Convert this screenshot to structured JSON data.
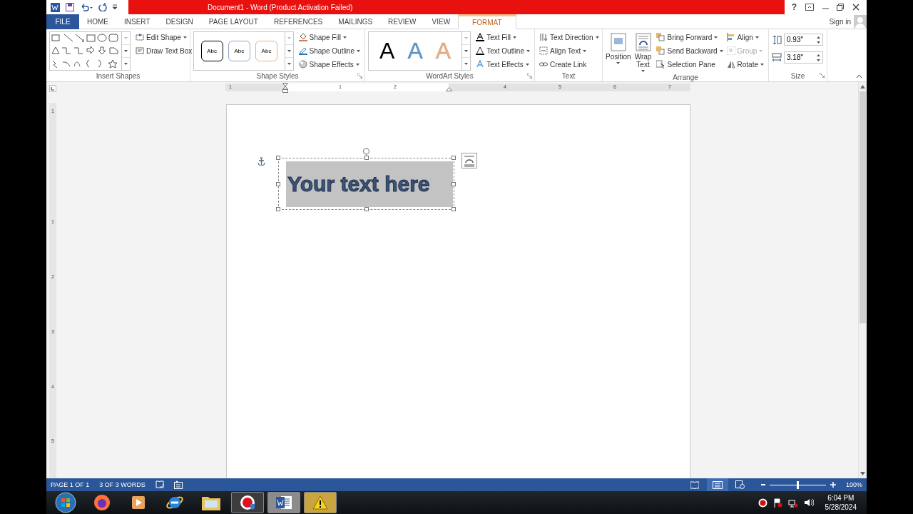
{
  "title_bar": {
    "title": "Document1 - Word (Product Activation Failed)",
    "help": "?"
  },
  "tabs": [
    {
      "label": "FILE",
      "kind": "file",
      "selected": false
    },
    {
      "label": "HOME",
      "kind": "plain",
      "selected": false
    },
    {
      "label": "INSERT",
      "kind": "plain",
      "selected": false
    },
    {
      "label": "DESIGN",
      "kind": "plain",
      "selected": false
    },
    {
      "label": "PAGE LAYOUT",
      "kind": "plain",
      "selected": false
    },
    {
      "label": "REFERENCES",
      "kind": "plain",
      "selected": false
    },
    {
      "label": "MAILINGS",
      "kind": "plain",
      "selected": false
    },
    {
      "label": "REVIEW",
      "kind": "plain",
      "selected": false
    },
    {
      "label": "VIEW",
      "kind": "plain",
      "selected": false
    },
    {
      "label": "FORMAT",
      "kind": "contextual",
      "selected": true
    }
  ],
  "sign_in": "Sign in",
  "ribbon": {
    "insert_shapes": {
      "label": "Insert Shapes",
      "commands": [
        {
          "label": "Edit Shape",
          "kind": "edit-shape",
          "dropdown": true,
          "disabled": false
        },
        {
          "label": "Draw Text Box",
          "kind": "text-box",
          "dropdown": false,
          "disabled": false
        }
      ]
    },
    "shape_styles": {
      "label": "Shape Styles",
      "previews": [
        {
          "label": "Abc",
          "color": "#000000"
        },
        {
          "label": "Abc",
          "color": "#8fa9c4"
        },
        {
          "label": "Abc",
          "color": "#e0b487"
        }
      ],
      "commands": [
        {
          "label": "Shape Fill",
          "kind": "fill",
          "dropdown": true,
          "disabled": false
        },
        {
          "label": "Shape Outline",
          "kind": "outline",
          "dropdown": true,
          "disabled": false
        },
        {
          "label": "Shape Effects",
          "kind": "effects",
          "dropdown": true,
          "disabled": false
        }
      ]
    },
    "wordart_styles": {
      "label": "WordArt Styles",
      "previews": [
        {
          "label": "A",
          "color": "#000000"
        },
        {
          "label": "A",
          "color": "#5b9bd5"
        },
        {
          "label": "A",
          "color": "#f4b183"
        }
      ],
      "commands": [
        {
          "label": "Text Fill",
          "kind": "text-fill",
          "dropdown": true,
          "disabled": false
        },
        {
          "label": "Text Outline",
          "kind": "text-outline",
          "dropdown": true,
          "disabled": false
        },
        {
          "label": "Text Effects",
          "kind": "text-effects",
          "dropdown": true,
          "disabled": false
        }
      ]
    },
    "text": {
      "label": "Text",
      "commands": [
        {
          "label": "Text Direction",
          "kind": "direction",
          "dropdown": true,
          "disabled": false
        },
        {
          "label": "Align Text",
          "kind": "align-text",
          "dropdown": true,
          "disabled": false
        },
        {
          "label": "Create Link",
          "kind": "link",
          "dropdown": false,
          "disabled": false
        }
      ]
    },
    "arrange": {
      "label": "Arrange",
      "big_buttons": [
        {
          "label": "Position",
          "kind": "position"
        },
        {
          "label": "Wrap Text",
          "kind": "wrap"
        }
      ],
      "commands": [
        {
          "label": "Bring Forward",
          "kind": "bring-forward",
          "dropdown": true,
          "disabled": false
        },
        {
          "label": "Send Backward",
          "kind": "send-backward",
          "dropdown": true,
          "disabled": false
        },
        {
          "label": "Selection Pane",
          "kind": "selection-pane",
          "dropdown": false,
          "disabled": false
        },
        {
          "label": "Align",
          "kind": "align",
          "dropdown": true,
          "disabled": false
        },
        {
          "label": "Group",
          "kind": "group",
          "dropdown": true,
          "disabled": true
        },
        {
          "label": "Rotate",
          "kind": "rotate",
          "dropdown": true,
          "disabled": false
        }
      ]
    },
    "size": {
      "label": "Size",
      "height": "0.93\"",
      "width": "3.18\""
    }
  },
  "horizontal_ruler": [
    "1",
    "1",
    "2",
    "4",
    "5",
    "6",
    "7"
  ],
  "vertical_ruler": [
    "1",
    "1",
    "2",
    "3",
    "4",
    "5"
  ],
  "document": {
    "text_box": "Your text here"
  },
  "status_bar": {
    "page": "PAGE 1 OF 1",
    "words": "3 OF 3 WORDS",
    "views": [
      {
        "kind": "read",
        "selected": false
      },
      {
        "kind": "print",
        "selected": true
      },
      {
        "kind": "web",
        "selected": false
      }
    ],
    "zoom": {
      "level": 0.5,
      "reading": "100%"
    }
  },
  "taskbar": {
    "items": [
      {
        "kind": "start",
        "open": false
      },
      {
        "kind": "firefox",
        "open": false
      },
      {
        "kind": "media",
        "open": false
      },
      {
        "kind": "ie",
        "open": false
      },
      {
        "kind": "folder",
        "open": false
      },
      {
        "kind": "recorder",
        "open": true,
        "color": "#3c3c3c"
      },
      {
        "kind": "word",
        "open": true,
        "color": "#8c8c8c"
      },
      {
        "kind": "alert",
        "open": true,
        "color": "#c9a440"
      }
    ],
    "time": "6:04 PM",
    "date": "5/28/2024"
  }
}
